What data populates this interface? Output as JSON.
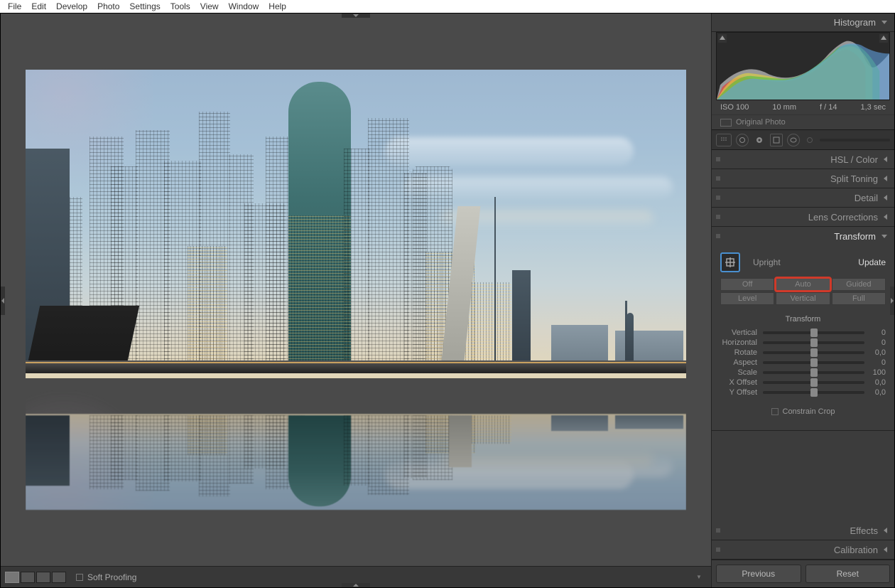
{
  "menubar": [
    "File",
    "Edit",
    "Develop",
    "Photo",
    "Settings",
    "Tools",
    "View",
    "Window",
    "Help"
  ],
  "right": {
    "histogram_label": "Histogram",
    "meta": {
      "iso": "ISO 100",
      "focal": "10 mm",
      "aperture": "f / 14",
      "shutter": "1,3 sec"
    },
    "original_photo": "Original Photo",
    "panels": {
      "hsl": "HSL / Color",
      "split": "Split Toning",
      "detail": "Detail",
      "lens": "Lens Corrections",
      "transform": "Transform",
      "effects": "Effects",
      "calibration": "Calibration"
    }
  },
  "transform": {
    "upright_label": "Upright",
    "update_label": "Update",
    "modes": [
      {
        "k": "off",
        "label": "Off"
      },
      {
        "k": "auto",
        "label": "Auto"
      },
      {
        "k": "guided",
        "label": "Guided"
      },
      {
        "k": "level",
        "label": "Level"
      },
      {
        "k": "vertical",
        "label": "Vertical"
      },
      {
        "k": "full",
        "label": "Full"
      }
    ],
    "highlighted_mode": "auto",
    "section_title": "Transform",
    "sliders": [
      {
        "k": "vertical",
        "label": "Vertical",
        "value": "0",
        "pos": 50
      },
      {
        "k": "horizontal",
        "label": "Horizontal",
        "value": "0",
        "pos": 50
      },
      {
        "k": "rotate",
        "label": "Rotate",
        "value": "0,0",
        "pos": 50
      },
      {
        "k": "aspect",
        "label": "Aspect",
        "value": "0",
        "pos": 50
      },
      {
        "k": "scale",
        "label": "Scale",
        "value": "100",
        "pos": 50
      },
      {
        "k": "xoffset",
        "label": "X Offset",
        "value": "0,0",
        "pos": 50
      },
      {
        "k": "yoffset",
        "label": "Y Offset",
        "value": "0,0",
        "pos": 50
      }
    ],
    "constrain_crop": "Constrain Crop"
  },
  "toolbar": {
    "soft_proofing": "Soft Proofing"
  },
  "buttons": {
    "previous": "Previous",
    "reset": "Reset"
  }
}
